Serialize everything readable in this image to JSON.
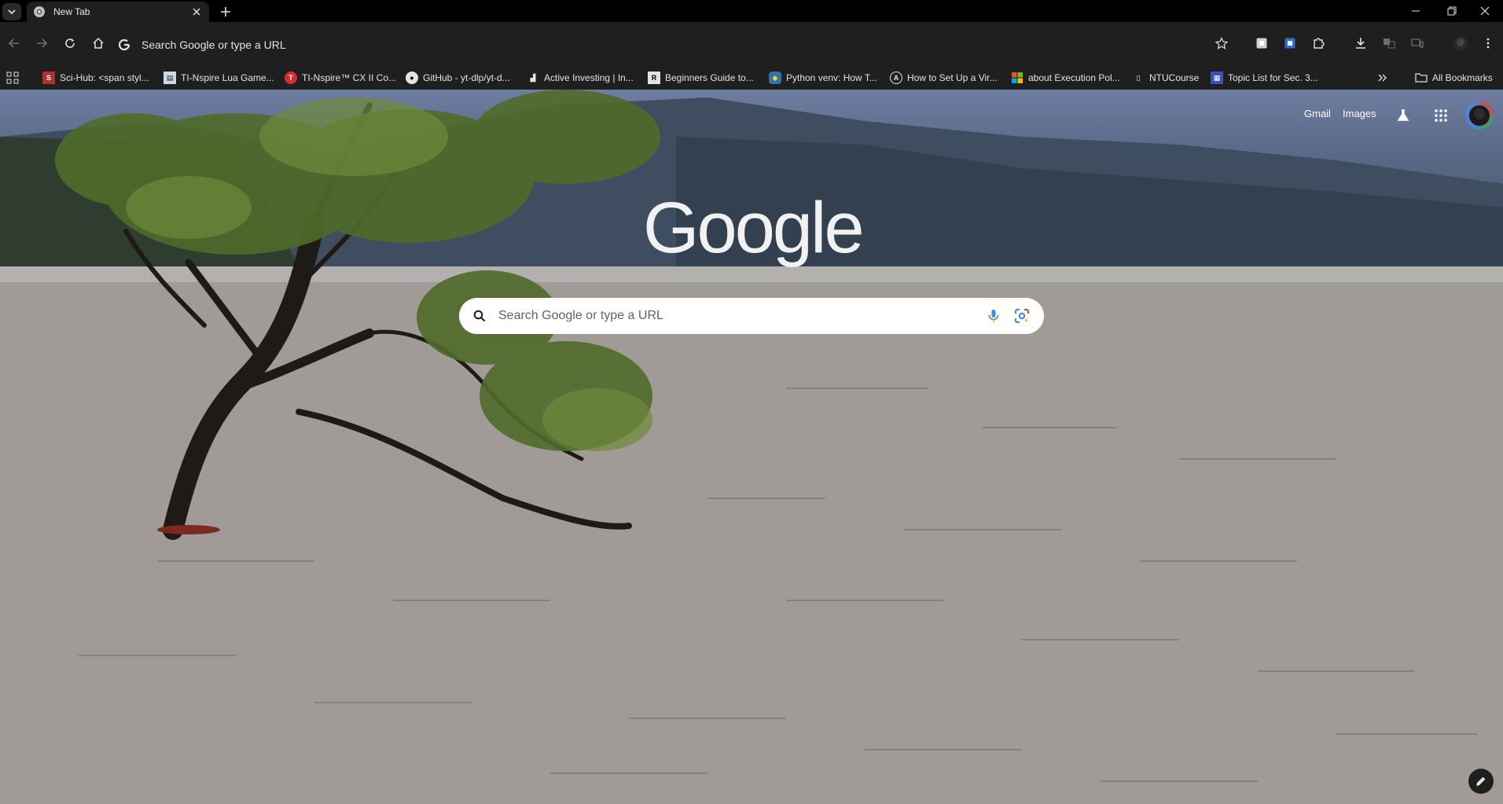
{
  "tab": {
    "title": "New Tab"
  },
  "toolbar": {
    "omnibox_text": "Search Google or type a URL"
  },
  "bookmarks": [
    {
      "label": "Sci-Hub: <span styl...",
      "icon": "scihub-icon"
    },
    {
      "label": "TI-Nspire Lua Game...",
      "icon": "doc-icon"
    },
    {
      "label": "TI-Nspire™ CX II Co...",
      "icon": "ti-icon"
    },
    {
      "label": "GitHub - yt-dlp/yt-d...",
      "icon": "github-icon"
    },
    {
      "label": "Active Investing | In...",
      "icon": "chart-icon"
    },
    {
      "label": "Beginners Guide to...",
      "icon": "bookmark-icon"
    },
    {
      "label": "Python venv: How T...",
      "icon": "python-icon"
    },
    {
      "label": "How to Set Up a Vir...",
      "icon": "a-icon"
    },
    {
      "label": "about Execution Pol...",
      "icon": "microsoft-icon"
    },
    {
      "label": "NTUCourse",
      "icon": "ntu-icon"
    },
    {
      "label": "Topic List for Sec. 3...",
      "icon": "calendar-icon"
    }
  ],
  "bookmarks_all": "All Bookmarks",
  "header_links": {
    "gmail": "Gmail",
    "images": "Images"
  },
  "logo_text": "Google",
  "search": {
    "placeholder": "Search Google or type a URL"
  },
  "colors": {
    "chrome_bg": "#1f1f1f",
    "tabstrip_bg": "#000000",
    "searchbox_bg": "#ffffff"
  }
}
